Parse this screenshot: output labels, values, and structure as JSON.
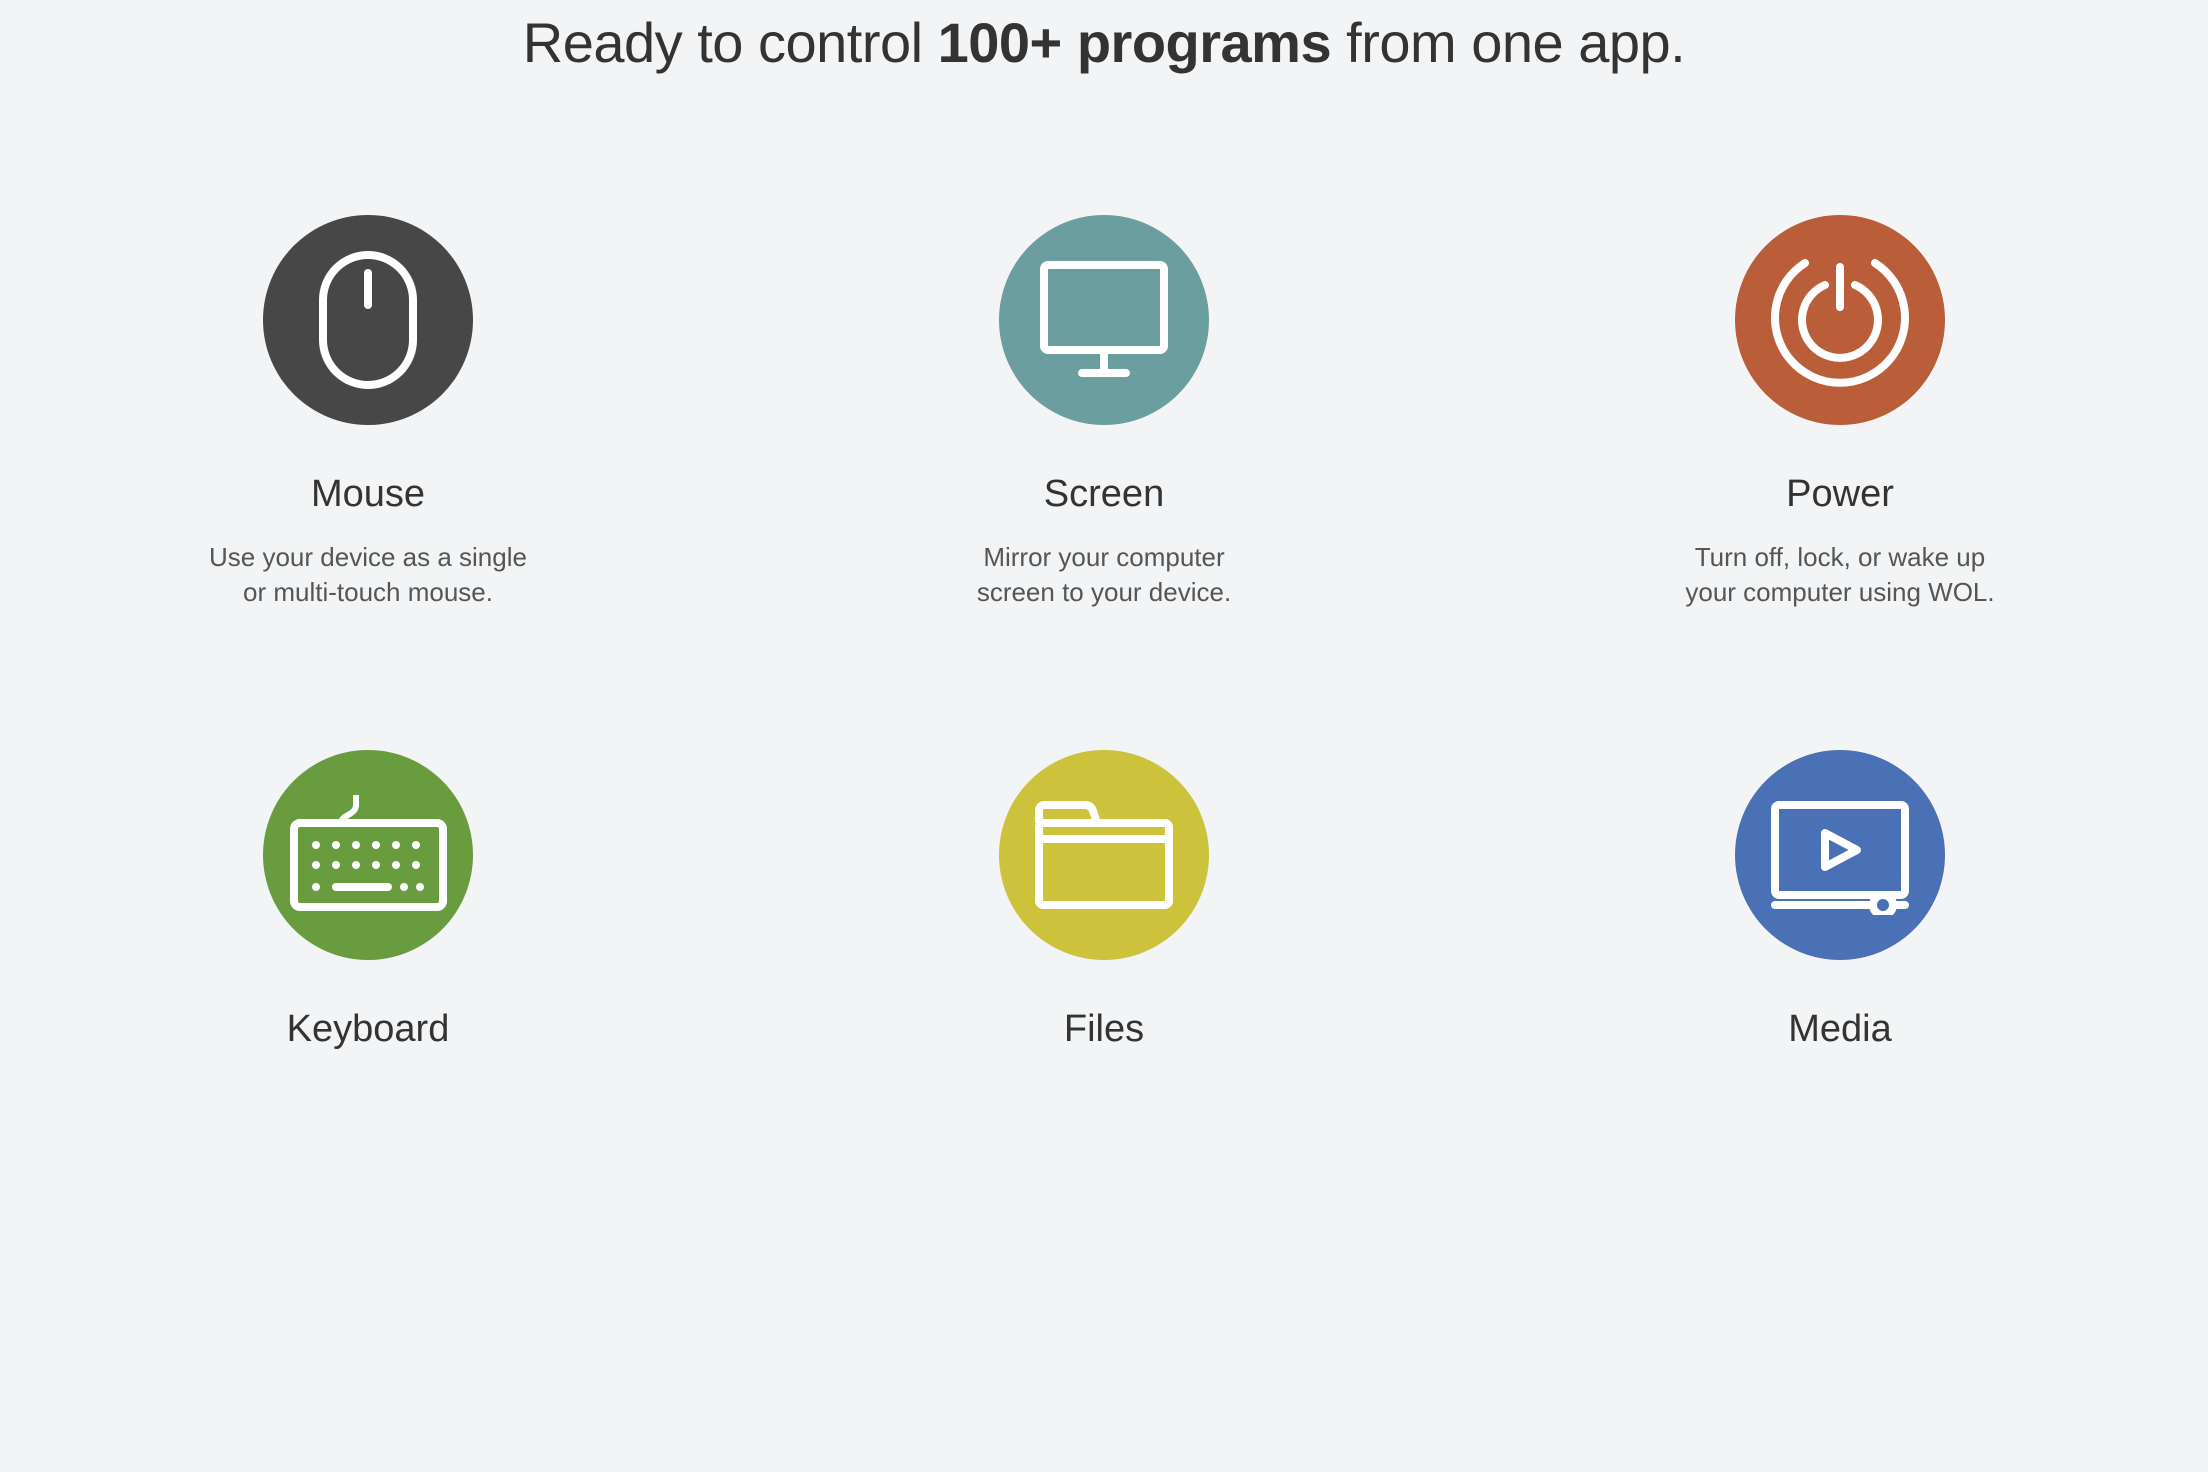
{
  "headline": {
    "pre": "Ready to control ",
    "bold": "100+ programs",
    "post": " from one app."
  },
  "colors": {
    "mouse": "#474747",
    "screen": "#6b9e9e",
    "power": "#ba5e3a",
    "keyboard": "#699b3f",
    "files": "#ccc23b",
    "media": "#4a70b6",
    "iconStroke": "#ffffff"
  },
  "features": [
    {
      "id": "mouse",
      "title": "Mouse",
      "desc": "Use your device as a single\nor multi-touch mouse.",
      "icon": "mouse-icon",
      "colorKey": "mouse"
    },
    {
      "id": "screen",
      "title": "Screen",
      "desc": "Mirror your computer\nscreen to your device.",
      "icon": "monitor-icon",
      "colorKey": "screen"
    },
    {
      "id": "power",
      "title": "Power",
      "desc": "Turn off, lock, or wake up\nyour computer using WOL.",
      "icon": "power-icon",
      "colorKey": "power"
    },
    {
      "id": "keyboard",
      "title": "Keyboard",
      "desc": "",
      "icon": "keyboard-icon",
      "colorKey": "keyboard"
    },
    {
      "id": "files",
      "title": "Files",
      "desc": "",
      "icon": "folder-icon",
      "colorKey": "files"
    },
    {
      "id": "media",
      "title": "Media",
      "desc": "",
      "icon": "media-icon",
      "colorKey": "media"
    }
  ]
}
